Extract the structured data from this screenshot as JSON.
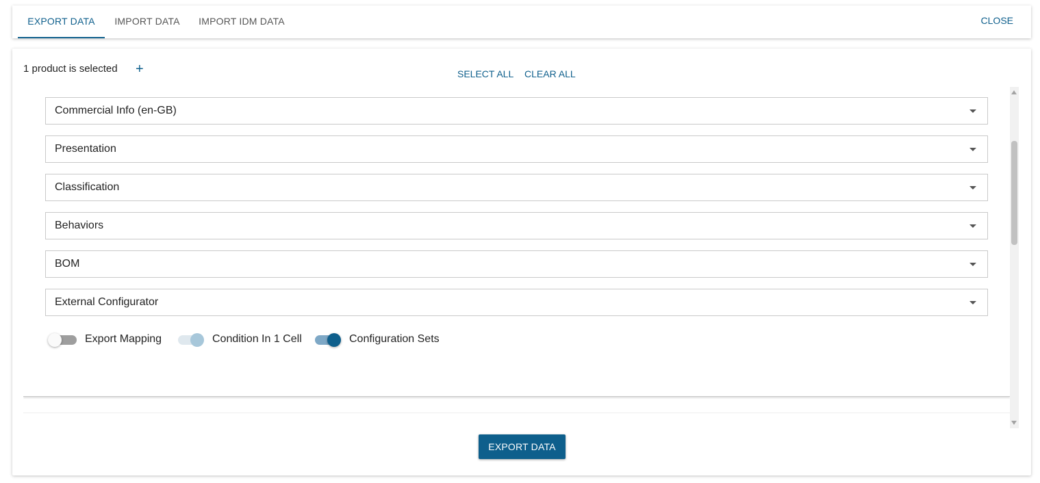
{
  "tabs": {
    "export": "EXPORT DATA",
    "import": "IMPORT DATA",
    "import_idm": "IMPORT IDM DATA",
    "active": "export"
  },
  "header": {
    "close_label": "CLOSE"
  },
  "selection": {
    "text": "1 product is selected",
    "add_icon": "plus-icon",
    "select_all": "SELECT ALL",
    "clear_all": "CLEAR ALL"
  },
  "sections": [
    "Commercial Info (en-GB)",
    "Presentation",
    "Classification",
    "Behaviors",
    "BOM",
    "External Configurator"
  ],
  "toggles": [
    {
      "label": "Export Mapping",
      "state": "off"
    },
    {
      "label": "Condition In 1 Cell",
      "state": "on-disabled"
    },
    {
      "label": "Configuration Sets",
      "state": "on"
    }
  ],
  "next_section": {
    "title": ""
  },
  "footer": {
    "export_button": "EXPORT DATA"
  },
  "colors": {
    "accent": "#0e5f8c"
  }
}
